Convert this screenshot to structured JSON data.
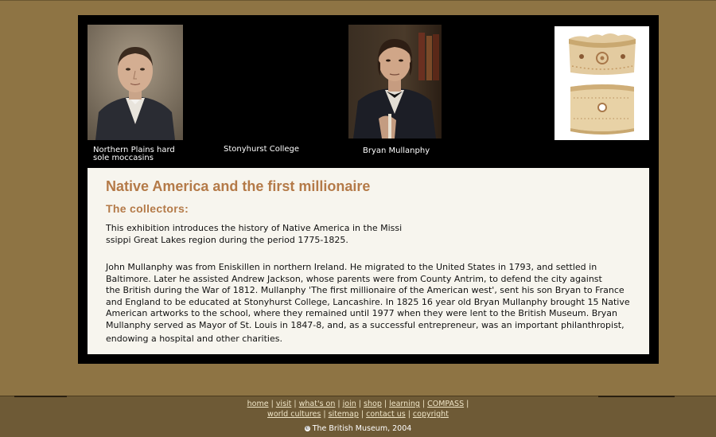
{
  "gallery": {
    "caption_1": "Northern Plains hard\nsole moccasins",
    "caption_2": "Stonyhurst College",
    "caption_3": "Bryan Mullanphy"
  },
  "article": {
    "title": "Native America and the first millionaire",
    "subtitle": "The collectors:",
    "p1": "This exhibition introduces the history of Native America in the Missi\nssippi Great Lakes region during the period 1775-1825.",
    "p2": "John Mullanphy was from Eniskillen in northern Ireland. He migrated to the United States in 1793, and settled in\nBaltimore. Later he assisted Andrew Jackson, whose parents were from County Antrim, to defend the city against\nthe British during the War of 1812. Mullanphy 'The first millionaire of the American west', sent his son Bryan to France\nand England to be educated at Stonyhurst College, Lancashire. In 1825 16 year old Bryan Mullanphy brought 15 Native\n American artworks to the school, where they remained until 1977 when they were lent to the British Museum. Bryan\nMullanphy served as Mayor of St. Louis in 1847-8, and, as a successful entrepreneur, was an important philanthropist,",
    "p3": "endowing a hospital and other charities."
  },
  "footer": {
    "links_row1": [
      "home",
      "visit",
      "what's on",
      "join",
      "shop",
      "learning",
      "COMPASS"
    ],
    "links_row2": [
      "world cultures",
      "sitemap",
      "contact us",
      "copyright"
    ],
    "copyright_symbol": "©",
    "copyright": "The British Museum, 2004"
  }
}
